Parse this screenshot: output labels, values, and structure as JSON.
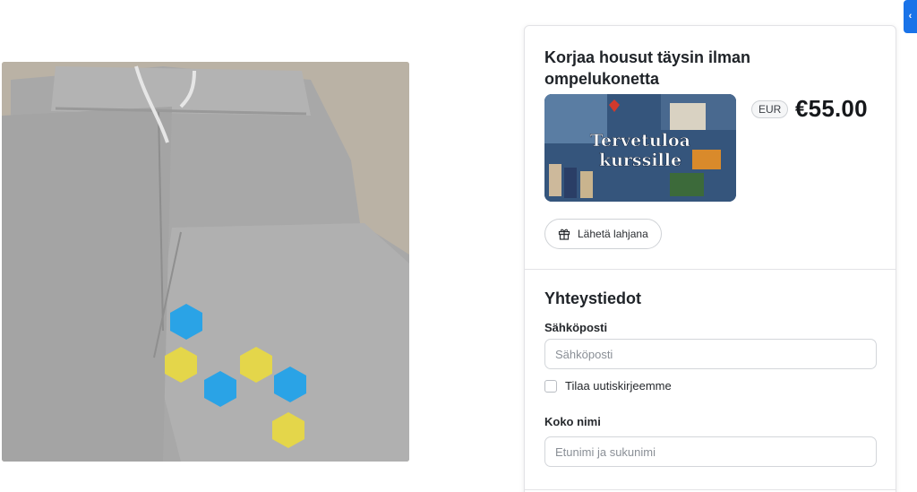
{
  "product": {
    "title": "Korjaa housut täysin ilman ompelukonetta",
    "thumbnail_text_line1": "Tervetuloa",
    "thumbnail_text_line2": "kurssille",
    "currency": "EUR",
    "price": "€55.00",
    "gift_button_label": "Lähetä lahjana"
  },
  "contact": {
    "section_title": "Yhteystiedot",
    "email_label": "Sähköposti",
    "email_placeholder": "Sähköposti",
    "email_value": "",
    "newsletter_label": "Tilaa uutiskirjeemme",
    "newsletter_checked": false,
    "name_label": "Koko nimi",
    "name_placeholder": "Etunimi ja sukunimi",
    "name_value": ""
  },
  "icons": {
    "gift": "gift-icon",
    "edge_tab": "chevron-left-icon"
  },
  "colors": {
    "accent": "#1a73e8",
    "patch_blue": "#2aa3e6",
    "patch_yellow": "#e4d64a"
  }
}
